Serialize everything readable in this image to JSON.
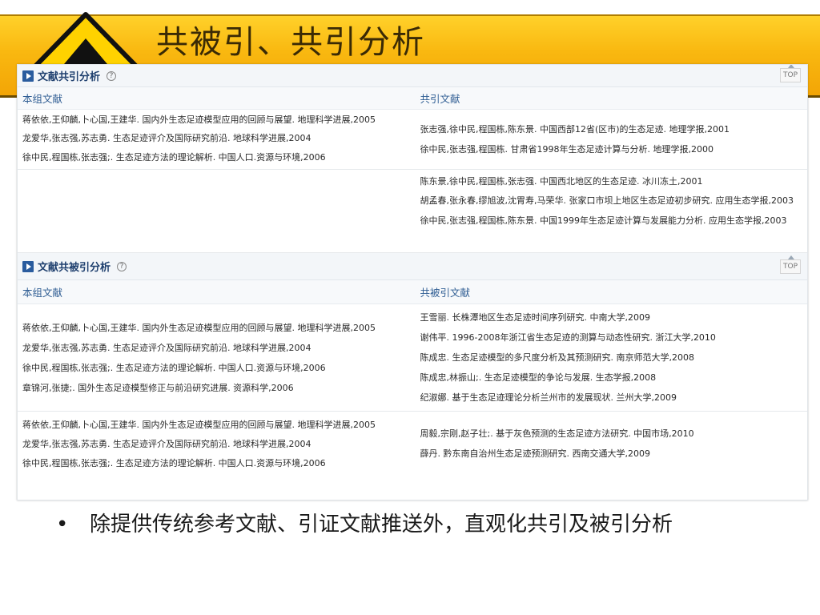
{
  "slide": {
    "title": "共被引、共引分析",
    "bullet_marker": "•",
    "bullet_text": "除提供传统参考文献、引证文献推送外，直观化共引及被引分析",
    "colors": {
      "banner": "#f9b810",
      "triangle_fill": "#ffd200",
      "triangle_stroke": "#111111"
    }
  },
  "top_label": "TOP",
  "help_glyph": "?",
  "cocitation": {
    "title": "文献共引分析",
    "col_left": "本组文献",
    "col_right": "共引文献",
    "rows": [
      {
        "left": [
          "蒋依依,王仰麟,卜心国,王建华. 国内外生态足迹模型应用的回顾与展望. 地理科学进展,2005",
          "龙爱华,张志强,苏志勇. 生态足迹评介及国际研究前沿. 地球科学进展,2004",
          "徐中民,程国栋,张志强;. 生态足迹方法的理论解析. 中国人口.资源与环境,2006"
        ],
        "right": [
          "张志强,徐中民,程国栋,陈东景. 中国西部12省(区市)的生态足迹. 地理学报,2001",
          "徐中民,张志强,程国栋. 甘肃省1998年生态足迹计算与分析. 地理学报,2000"
        ]
      },
      {
        "left": [],
        "right": [
          "陈东景,徐中民,程国栋,张志强. 中国西北地区的生态足迹. 冰川冻土,2001",
          "胡孟春,张永春,缪旭波,沈胃寿,马荣华. 张家口市坝上地区生态足迹初步研究. 应用生态学报,2003",
          "徐中民,张志强,程国栋,陈东景. 中国1999年生态足迹计算与发展能力分析. 应用生态学报,2003"
        ]
      }
    ]
  },
  "cocited": {
    "title": "文献共被引分析",
    "col_left": "本组文献",
    "col_right": "共被引文献",
    "rows": [
      {
        "left": [
          "蒋依依,王仰麟,卜心国,王建华. 国内外生态足迹模型应用的回顾与展望. 地理科学进展,2005",
          "龙爱华,张志强,苏志勇. 生态足迹评介及国际研究前沿. 地球科学进展,2004",
          "徐中民,程国栋,张志强;. 生态足迹方法的理论解析. 中国人口.资源与环境,2006",
          "章锦河,张捷;. 国外生态足迹模型修正与前沿研究进展. 资源科学,2006"
        ],
        "right": [
          "王雪丽. 长株潭地区生态足迹时间序列研究. 中南大学,2009",
          "谢伟平. 1996-2008年浙江省生态足迹的测算与动态性研究. 浙江大学,2010",
          "陈成忠. 生态足迹模型的多尺度分析及其预测研究. 南京师范大学,2008",
          "陈成忠,林振山;. 生态足迹模型的争论与发展. 生态学报,2008",
          "纪淑娜. 基于生态足迹理论分析兰州市的发展现状. 兰州大学,2009"
        ]
      },
      {
        "left": [
          "蒋依依,王仰麟,卜心国,王建华. 国内外生态足迹模型应用的回顾与展望. 地理科学进展,2005",
          "龙爱华,张志强,苏志勇. 生态足迹评介及国际研究前沿. 地球科学进展,2004",
          "徐中民,程国栋,张志强;. 生态足迹方法的理论解析. 中国人口.资源与环境,2006"
        ],
        "right": [
          "周毅,宗刚,赵子壮;. 基于灰色预测的生态足迹方法研究. 中国市场,2010",
          "薛丹. 黔东南自治州生态足迹预测研究. 西南交通大学,2009"
        ]
      }
    ]
  }
}
